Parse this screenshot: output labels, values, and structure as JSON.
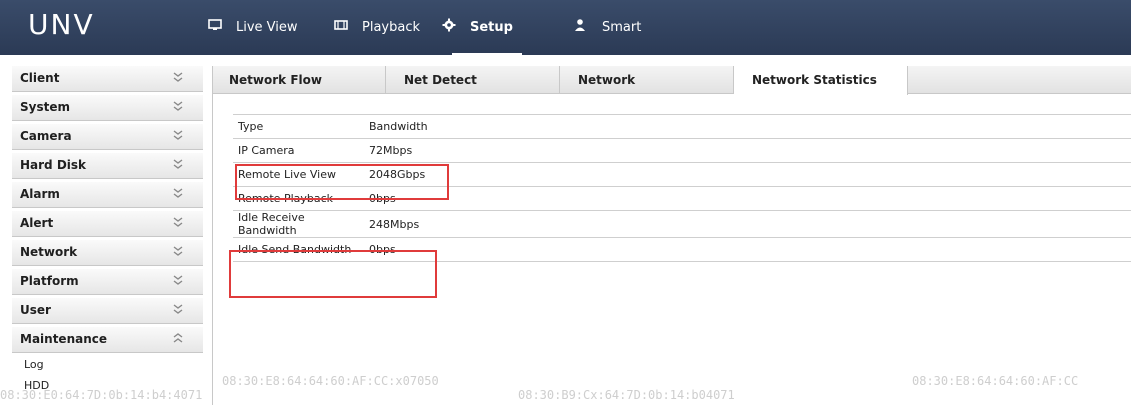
{
  "app": {
    "logo": "UNV"
  },
  "nav": {
    "items": [
      {
        "label": "Live View",
        "icon": "monitor-icon"
      },
      {
        "label": "Playback",
        "icon": "film-icon"
      },
      {
        "label": "Setup",
        "icon": "gear-icon",
        "active": true
      },
      {
        "label": "Smart",
        "icon": "person-icon"
      }
    ]
  },
  "sidebar": {
    "items": [
      {
        "label": "Client",
        "state": "collapsed"
      },
      {
        "label": "System",
        "state": "collapsed"
      },
      {
        "label": "Camera",
        "state": "collapsed"
      },
      {
        "label": "Hard Disk",
        "state": "collapsed"
      },
      {
        "label": "Alarm",
        "state": "collapsed"
      },
      {
        "label": "Alert",
        "state": "collapsed"
      },
      {
        "label": "Network",
        "state": "collapsed"
      },
      {
        "label": "Platform",
        "state": "collapsed"
      },
      {
        "label": "User",
        "state": "collapsed"
      },
      {
        "label": "Maintenance",
        "state": "expanded"
      }
    ],
    "subitems": [
      "Log",
      "HDD"
    ]
  },
  "tabs": [
    {
      "label": "Network Flow"
    },
    {
      "label": "Net Detect"
    },
    {
      "label": "Network"
    },
    {
      "label": "Network Statistics",
      "active": true
    }
  ],
  "stats": {
    "header": {
      "col1": "Type",
      "col2": "Bandwidth"
    },
    "rows": [
      {
        "type": "IP Camera",
        "bandwidth": "72Mbps"
      },
      {
        "type": "Remote Live View",
        "bandwidth": "2048Gbps",
        "highlighted": true
      },
      {
        "type": "Remote Playback",
        "bandwidth": "0bps"
      },
      {
        "type": "Idle Receive Bandwidth",
        "bandwidth": "248Mbps"
      },
      {
        "type": "Idle Send Bandwidth",
        "bandwidth": "0bps",
        "highlighted": true
      }
    ]
  },
  "watermarks": [
    "08:30:E0:64:7D:0b:14:b4:4071",
    "08:30:E8:64:64:60:AF:CC:x07050",
    "08:30:B9:Cx:64:7D:0b:14:b04071",
    "08:30:E8:64:64:60:AF:CC"
  ],
  "colors": {
    "topbar": "#2f405d",
    "highlight_box": "#e03b3b",
    "sidebar_item_bg": "#efefef"
  }
}
